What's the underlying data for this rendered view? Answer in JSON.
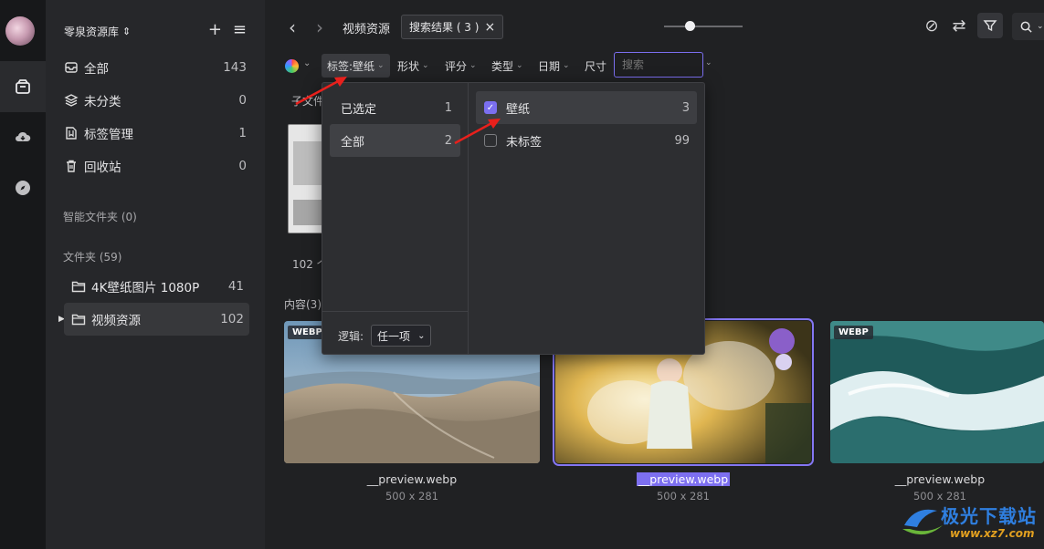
{
  "library": {
    "title": "零泉资源库",
    "add_icon": "+",
    "menu_icon": "≡"
  },
  "nav": [
    {
      "label": "全部",
      "count": "143",
      "icon": "inbox-icon"
    },
    {
      "label": "未分类",
      "count": "0",
      "icon": "layers-icon"
    },
    {
      "label": "标签管理",
      "count": "1",
      "icon": "tag-icon"
    },
    {
      "label": "回收站",
      "count": "0",
      "icon": "trash-icon"
    }
  ],
  "smart_folders": {
    "label": "智能文件夹 (0)"
  },
  "folders": {
    "label": "文件夹 (59)",
    "items": [
      {
        "name": "4K壁纸图片 1080P",
        "count": "41"
      },
      {
        "name": "视频资源",
        "count": "102"
      }
    ]
  },
  "topbar": {
    "breadcrumb": "视频资源",
    "tab_label": "搜索结果 ( 3 )",
    "tab_close": "×"
  },
  "filters": {
    "tag_label": "标签:壁纸",
    "shape": "形状",
    "rating": "评分",
    "type": "类型",
    "date": "日期",
    "size": "尺寸",
    "search_placeholder": "搜索"
  },
  "content": {
    "subfolder_label": "子文件",
    "subfolder_count": "102 个",
    "items_label": "内容(3)",
    "cards": [
      {
        "badge": "WEBP",
        "name": "__preview.webp",
        "dims": "500 x 281"
      },
      {
        "badge": "",
        "name": "__preview.webp",
        "dims": "500 x 281"
      },
      {
        "badge": "WEBP",
        "name": "__preview.webp",
        "dims": "500 x 281"
      }
    ]
  },
  "dropdown": {
    "left": [
      {
        "label": "已选定",
        "count": "1"
      },
      {
        "label": "全部",
        "count": "2"
      }
    ],
    "logic_label": "逻辑:",
    "logic_value": "任一项",
    "tags": [
      {
        "label": "壁纸",
        "count": "3",
        "checked": true
      },
      {
        "label": "未标签",
        "count": "99",
        "checked": false
      }
    ]
  },
  "watermark": {
    "text": "极光下载站",
    "url": "www.xz7.com"
  },
  "colors": {
    "accent": "#7b6ff0",
    "background": "#202123",
    "sidebar": "#26272a",
    "arrow": "#e8201c"
  }
}
